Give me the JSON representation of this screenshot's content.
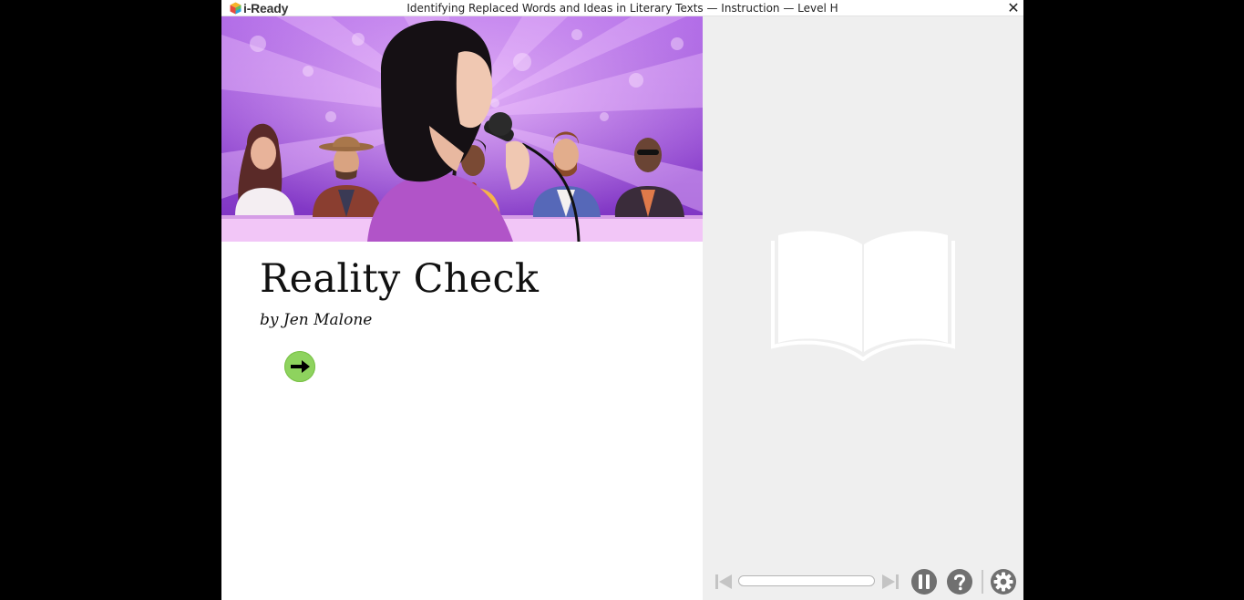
{
  "titlebar": {
    "logo_text": "i-Ready",
    "title": "Identifying Replaced Words and Ideas in Literary Texts — Instruction — Level H",
    "close_glyph": "✕"
  },
  "story": {
    "title": "Reality Check",
    "byline": "by Jen Malone"
  },
  "icons": {
    "logo": "i-ready-cube-icon",
    "close": "close-icon",
    "next": "right-arrow-icon",
    "book": "open-book-icon",
    "previous": "skip-back-icon",
    "forward": "skip-forward-icon",
    "pause": "pause-icon",
    "help": "help-icon",
    "settings": "gear-icon"
  },
  "colors": {
    "next_button": "#8ed35e",
    "controls_gray": "#707070",
    "controls_disabled": "#c4c4c4",
    "right_pane_bg": "#efefef",
    "hero_purple": "#9b3fd0"
  },
  "player": {
    "progress": 0
  }
}
